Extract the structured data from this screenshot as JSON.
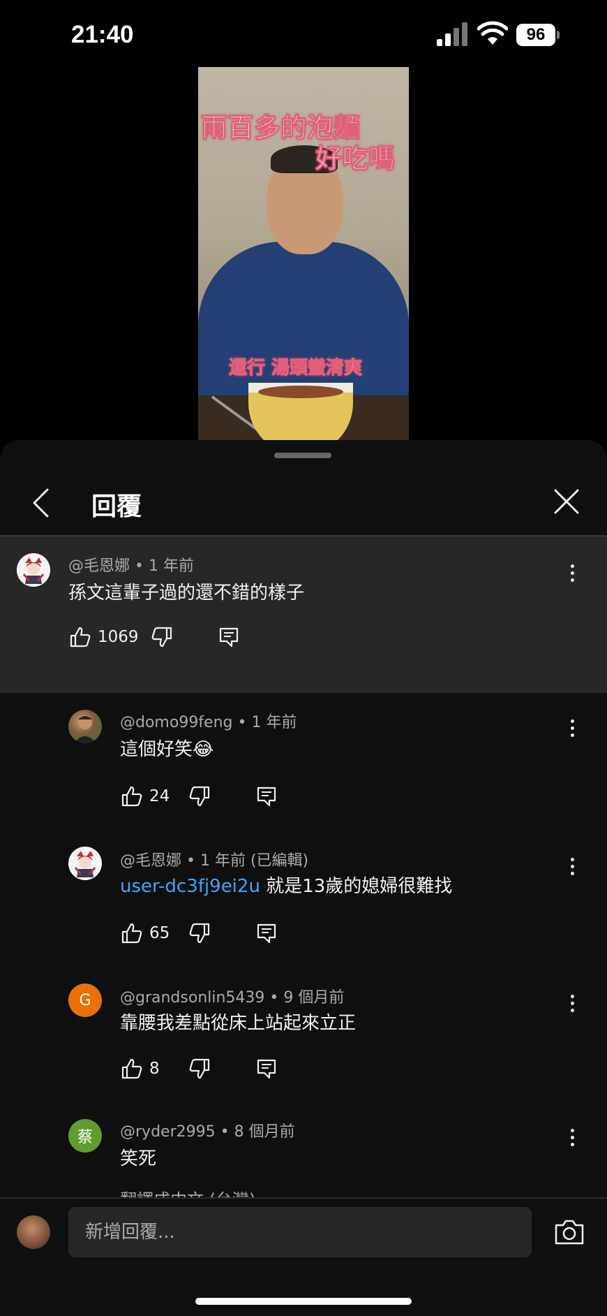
{
  "status_bar": {
    "time": "21:40",
    "battery": "96"
  },
  "video": {
    "caption_line1": "兩百多的泡麵",
    "caption_line2": "好吃嗎",
    "caption_line3": "還行  湯頭蠻清爽"
  },
  "panel": {
    "title": "回覆"
  },
  "comments": [
    {
      "author": "@毛恩娜",
      "time": "1 年前",
      "text": "孫文這輩子過的還不錯的樣子",
      "likes": "1069"
    },
    {
      "author": "@domo99feng",
      "time": "1 年前",
      "text": "這個好笑😂",
      "likes": "24"
    },
    {
      "author": "@毛恩娜",
      "time": "1 年前 (已編輯)",
      "mention": "user-dc3fj9ei2u",
      "text": " 就是13歲的媳婦很難找",
      "likes": "65"
    },
    {
      "author": "@grandsonlin5439",
      "time": "9 個月前",
      "text": "靠腰我差點從床上站起來立正",
      "likes": "8",
      "avatar_letter": "G",
      "avatar_color": "#e8710a"
    },
    {
      "author": "@ryder2995",
      "time": "8 個月前",
      "text": "笑死",
      "translate_label": "翻譯成中文 (台灣)",
      "avatar_letter": "蔡",
      "avatar_color": "#5e9e2f"
    }
  ],
  "reply_box": {
    "placeholder": "新增回覆..."
  },
  "icons": [
    "back-arrow-icon",
    "close-icon",
    "like-icon",
    "dislike-icon",
    "reply-icon",
    "more-vertical-icon",
    "camera-icon",
    "signal-icon",
    "wifi-icon"
  ]
}
